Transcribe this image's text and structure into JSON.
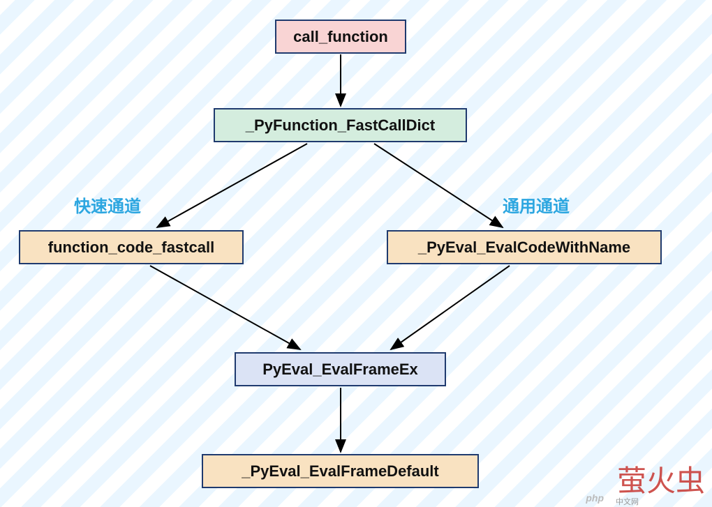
{
  "nodes": {
    "call_function": "call_function",
    "fastcall_dict": "_PyFunction_FastCallDict",
    "fastcall": "function_code_fastcall",
    "evalcode": "_PyEval_EvalCodeWithName",
    "evalframe": "PyEval_EvalFrameEx",
    "evaldefault": "_PyEval_EvalFrameDefault"
  },
  "labels": {
    "fast_channel": "快速通道",
    "general_channel": "通用通道"
  },
  "watermark": {
    "main": "萤火虫",
    "small": "中文网",
    "php": "php"
  }
}
